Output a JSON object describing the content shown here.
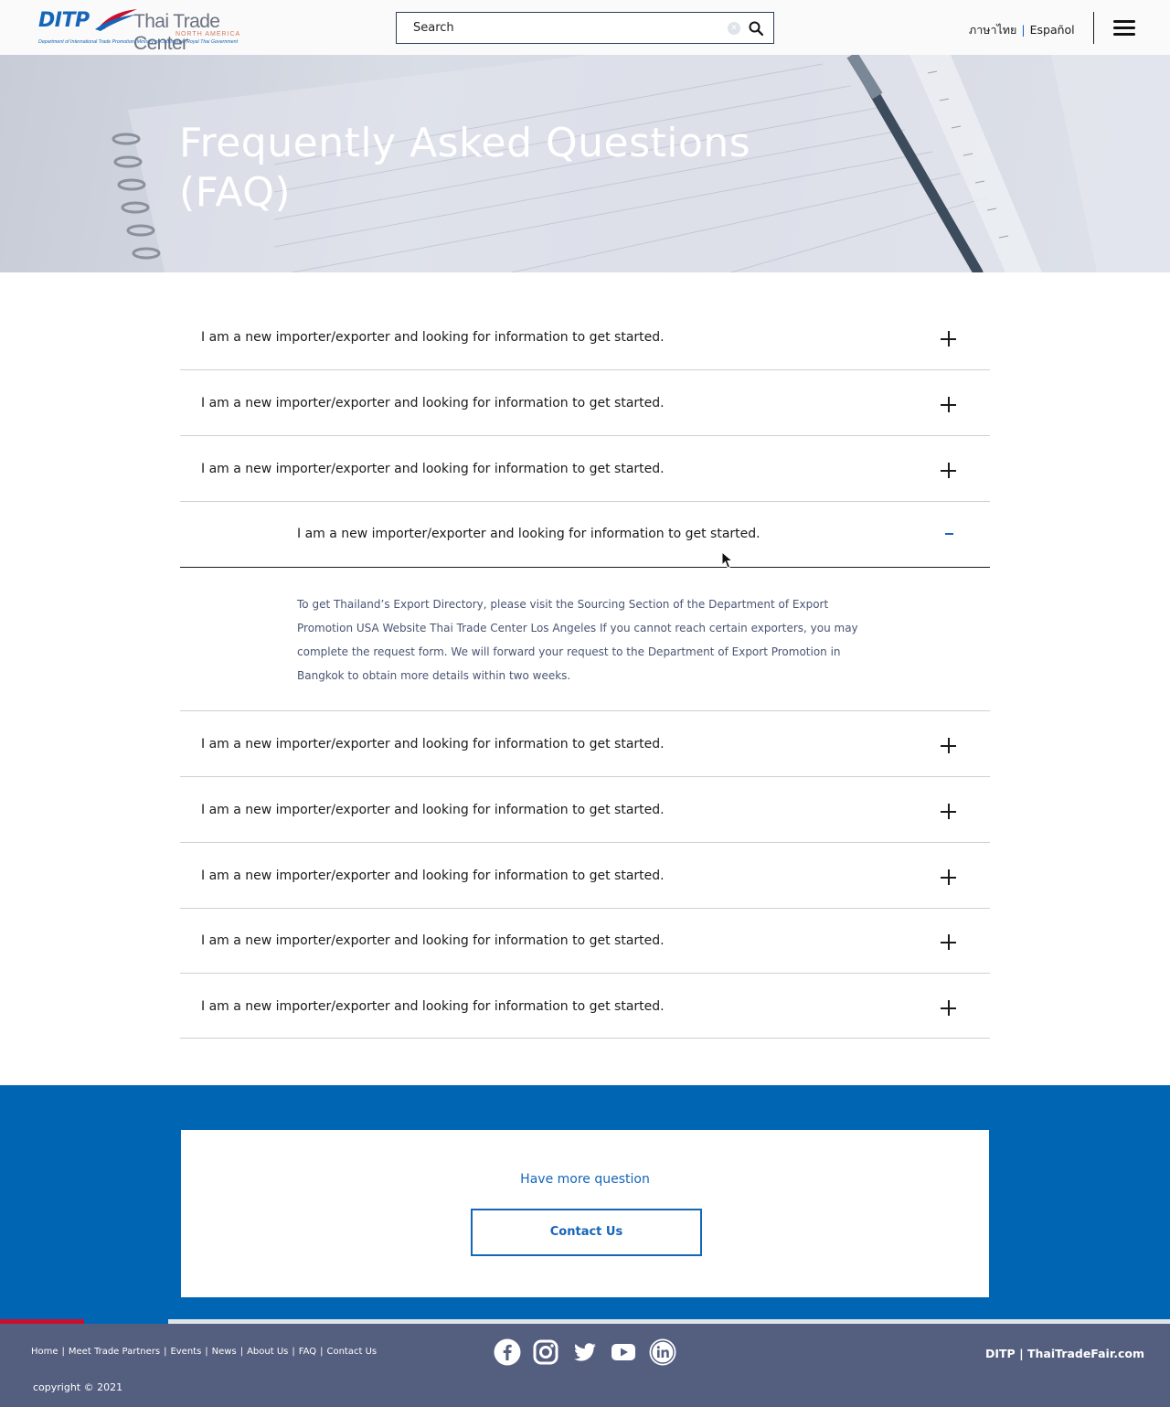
{
  "header": {
    "logo": {
      "ditp": "DITP",
      "center": "Thai Trade Center",
      "region": "NORTH AMERICA",
      "tagline": "Department of International Trade Promotion, Ministry of Commerce, Royal Thai Government"
    },
    "search": {
      "placeholder": "Search",
      "value": ""
    },
    "languages": [
      "ภาษาไทย",
      "Español"
    ]
  },
  "hero": {
    "title_line1": "Frequently Asked Questions",
    "title_line2": "(FAQ)"
  },
  "faq": {
    "items": [
      {
        "question": "I am a new importer/exporter and looking for information to get started.",
        "open": false
      },
      {
        "question": "I am a new importer/exporter and looking for information to get started.",
        "open": false
      },
      {
        "question": "I am a new importer/exporter and looking for information to get started.",
        "open": false
      },
      {
        "question": "I am a new importer/exporter and looking for information to get started.",
        "open": true,
        "answer": "To get  Thailand’s Export Directory, please visit the Sourcing Section of the Department of Export Promotion USA Website Thai Trade Center Los Angeles If you cannot reach certain exporters, you may complete the request form. We will forward your request to the Department of Export Promotion in Bangkok to obtain more details within two weeks."
      },
      {
        "question": "I am a new importer/exporter and looking for information to get started.",
        "open": false
      },
      {
        "question": "I am a new importer/exporter and looking for information to get started.",
        "open": false
      },
      {
        "question": "I am a new importer/exporter and looking for information to get started.",
        "open": false
      },
      {
        "question": "I am a new importer/exporter and looking for information to get started.",
        "open": false
      },
      {
        "question": "I am a new importer/exporter and looking for information to get started.",
        "open": false
      }
    ]
  },
  "contact": {
    "prompt": "Have more question",
    "button": "Contact Us"
  },
  "footer": {
    "links": [
      "Home",
      "Meet Trade Partners",
      "Events",
      "News",
      "About Us",
      "FAQ",
      "Contact Us"
    ],
    "social": [
      "facebook-icon",
      "instagram-icon",
      "twitter-icon",
      "youtube-icon",
      "linkedin-icon"
    ],
    "brand": "DITP | ThaiTradeFair.com",
    "copyright": "copyright © 2021"
  },
  "colors": {
    "primary_blue": "#0066b3",
    "footer_bg": "#545e7e",
    "accent_red": "#c8102e"
  }
}
